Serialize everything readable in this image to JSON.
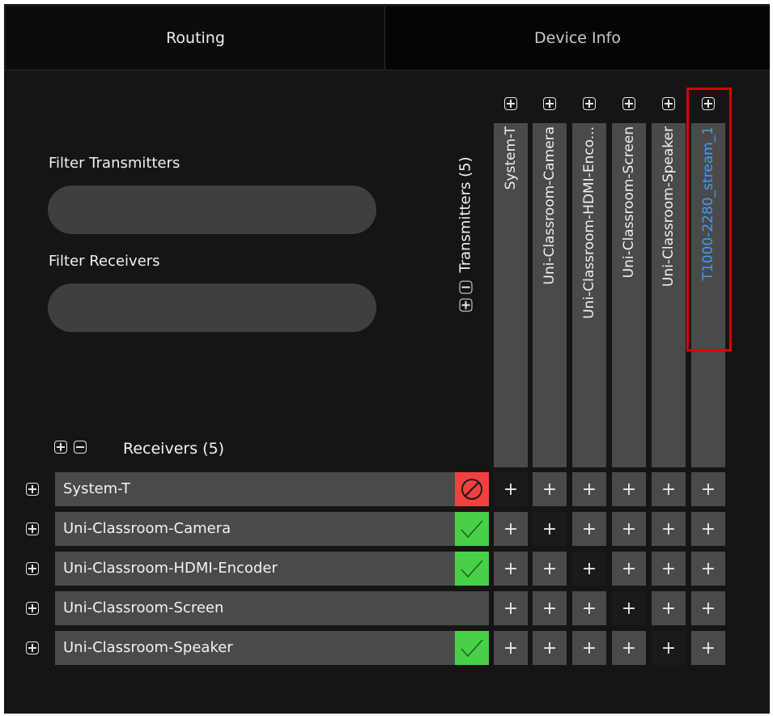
{
  "tabs": {
    "routing": "Routing",
    "device_info": "Device Info"
  },
  "filters": {
    "transmitters_label": "Filter Transmitters",
    "transmitters_value": "",
    "receivers_label": "Filter Receivers",
    "receivers_value": ""
  },
  "transmitters": {
    "heading": "Transmitters",
    "count": "(5)",
    "items": [
      {
        "label": "System-T"
      },
      {
        "label": "Uni-Classroom-Camera"
      },
      {
        "label": "Uni-Classroom-HDMI-Enco..."
      },
      {
        "label": "Uni-Classroom-Screen"
      },
      {
        "label": "Uni-Classroom-Speaker"
      },
      {
        "label": "T1000-2280_stream_1",
        "highlighted": true
      }
    ]
  },
  "receivers": {
    "heading": "Receivers",
    "count": "(5)",
    "items": [
      {
        "label": "System-T",
        "status": "error"
      },
      {
        "label": "Uni-Classroom-Camera",
        "status": "ok"
      },
      {
        "label": "Uni-Classroom-HDMI-Encoder",
        "status": "ok"
      },
      {
        "label": "Uni-Classroom-Screen",
        "status": "none"
      },
      {
        "label": "Uni-Classroom-Speaker",
        "status": "ok"
      }
    ]
  },
  "grid_cell_symbol": "+",
  "colors": {
    "status_error": "#f24040",
    "status_ok": "#48d048",
    "highlight_border": "#e00000",
    "highlight_text": "#3f9bff"
  },
  "icons": {
    "expand": "plus-square-icon",
    "collapse": "minus-square-icon",
    "error": "prohibited-icon",
    "ok": "checkmark-icon"
  }
}
